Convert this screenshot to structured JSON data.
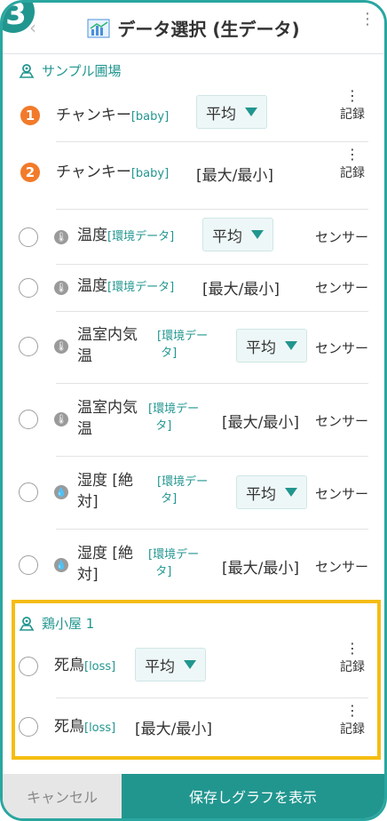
{
  "header": {
    "step": "3",
    "title": "データ選択 (生データ)"
  },
  "sections": [
    {
      "label": "サンプル圃場"
    },
    {
      "label": "鶏小屋 1"
    }
  ],
  "rows": [
    {
      "badge": "1",
      "name": "チャンキー",
      "tag": "[baby]",
      "agg": "平均",
      "right": "記録"
    },
    {
      "badge": "2",
      "name": "チャンキー",
      "tag": "[baby]",
      "agg": "[最大/最小]",
      "right": "記録"
    },
    {
      "name": "温度",
      "tag": "[環境データ]",
      "agg": "平均",
      "right": "センサー"
    },
    {
      "name": "温度",
      "tag": "[環境データ]",
      "agg": "[最大/最小]",
      "right": "センサー"
    },
    {
      "name_l1": "温室内気",
      "name_l2": "温",
      "tag_l1": "[環境デー",
      "tag_l2": "タ]",
      "agg": "平均",
      "right": "センサー"
    },
    {
      "name_l1": "温室内気",
      "name_l2": "温",
      "tag_l1": "[環境デー",
      "tag_l2": "タ]",
      "agg": "[最大/最小]",
      "right": "センサー"
    },
    {
      "name_l1": "湿度 [絶",
      "name_l2": "対]",
      "tag_l1": "[環境デー",
      "tag_l2": "タ]",
      "agg": "平均",
      "right": "センサー"
    },
    {
      "name_l1": "湿度 [絶",
      "name_l2": "対]",
      "tag_l1": "[環境デー",
      "tag_l2": "タ]",
      "agg": "[最大/最小]",
      "right": "センサー"
    },
    {
      "name": "死鳥",
      "tag": "[loss]",
      "agg": "平均",
      "right": "記録"
    },
    {
      "name": "死鳥",
      "tag": "[loss]",
      "agg": "[最大/最小]",
      "right": "記録"
    }
  ],
  "footer": {
    "cancel": "キャンセル",
    "save": "保存しグラフを表示"
  },
  "colors": {
    "accent": "#21968f",
    "badge": "#f27a2a",
    "highlight": "#f5bd12"
  },
  "icons": {
    "title": "bar-chart-icon",
    "section": "location-pin-icon",
    "more": "kebab-icon",
    "sensor": "thermometer-icon"
  }
}
